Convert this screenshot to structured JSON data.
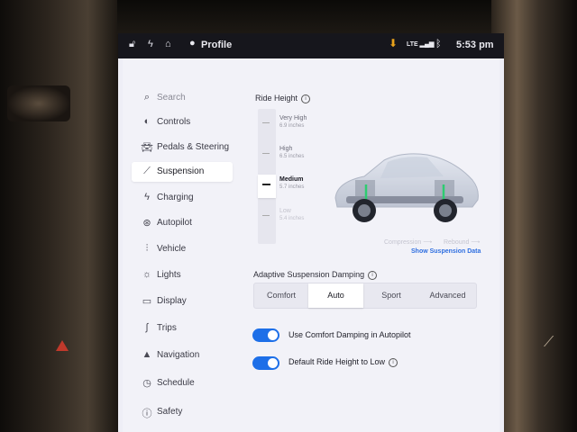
{
  "status_bar": {
    "profile_label": "Profile",
    "network": "LTE",
    "time": "5:53 pm"
  },
  "sidebar": {
    "search_label": "Search",
    "items": [
      {
        "label": "Controls",
        "icon": "toggle-icon"
      },
      {
        "label": "Pedals & Steering",
        "icon": "car-icon"
      },
      {
        "label": "Suspension",
        "icon": "suspension-icon",
        "active": true
      },
      {
        "label": "Charging",
        "icon": "lightning-icon"
      },
      {
        "label": "Autopilot",
        "icon": "steering-wheel-icon"
      },
      {
        "label": "Vehicle",
        "icon": "sliders-icon"
      },
      {
        "label": "Lights",
        "icon": "sun-icon"
      },
      {
        "label": "Display",
        "icon": "display-icon"
      },
      {
        "label": "Trips",
        "icon": "trips-icon"
      },
      {
        "label": "Navigation",
        "icon": "navigation-arrow-icon"
      },
      {
        "label": "Schedule",
        "icon": "clock-icon"
      },
      {
        "label": "Safety",
        "icon": "safety-icon"
      }
    ]
  },
  "ride_height": {
    "title": "Ride Height",
    "options": [
      {
        "label": "Very High",
        "value": "6.9 inches"
      },
      {
        "label": "High",
        "value": "6.5 inches"
      },
      {
        "label": "Medium",
        "value": "5.7 inches",
        "selected": true
      },
      {
        "label": "Low",
        "value": "5.4 inches"
      }
    ],
    "legend_compression": "Compression",
    "legend_rebound": "Rebound",
    "show_data_link": "Show Suspension Data"
  },
  "damping": {
    "title": "Adaptive Suspension Damping",
    "options": [
      "Comfort",
      "Auto",
      "Sport",
      "Advanced"
    ],
    "selected": "Auto"
  },
  "toggles": [
    {
      "label": "Use Comfort Damping in Autopilot",
      "on": true
    },
    {
      "label": "Default Ride Height to Low",
      "on": true
    }
  ],
  "colors": {
    "accent": "#1d6fe8",
    "download": "#e8a21b",
    "link": "#2f6fe0"
  }
}
